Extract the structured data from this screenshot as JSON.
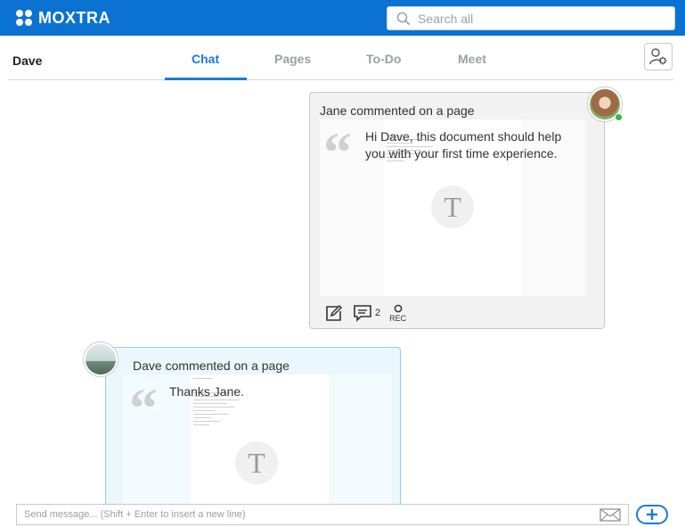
{
  "brand": {
    "name": "MOXTRA"
  },
  "search": {
    "placeholder": "Search all"
  },
  "header": {
    "user_name": "Dave",
    "tabs": [
      {
        "label": "Chat",
        "active": true
      },
      {
        "label": "Pages",
        "active": false
      },
      {
        "label": "To-Do",
        "active": false
      },
      {
        "label": "Meet",
        "active": false
      }
    ]
  },
  "messages": [
    {
      "title": "Jane commented on a page",
      "comment": "Hi Dave, this document should help you with your first time experience.",
      "preview_letter": "T",
      "comment_count": "2",
      "rec_label": "REC",
      "status": "online"
    },
    {
      "title": "Dave commented on a page",
      "comment": "Thanks Jane.",
      "preview_letter": "T"
    }
  ],
  "composer": {
    "placeholder": "Send message... (Shift + Enter to insert a new line)"
  },
  "colors": {
    "brand": "#0a72d0",
    "accent": "#1a7cd3",
    "online": "#3bb54a"
  },
  "icons": [
    "search-icon",
    "contact-settings-icon",
    "edit-icon",
    "comment-icon",
    "record-icon",
    "email-icon",
    "add-icon"
  ]
}
